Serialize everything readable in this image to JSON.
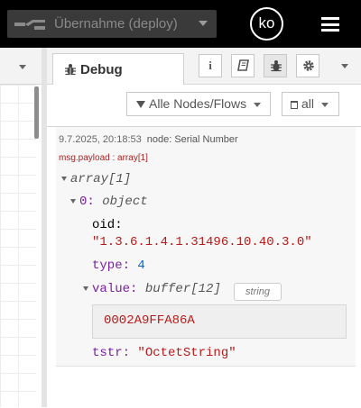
{
  "header": {
    "deploy_label": "Übernahme (deploy)",
    "avatar_initials": "ko"
  },
  "sidebar": {
    "tab_title": "Debug",
    "buttons": [
      "info",
      "help",
      "debug",
      "settings"
    ]
  },
  "filter": {
    "scope_label": "Alle Nodes/Flows",
    "clear_label": "all"
  },
  "message": {
    "timestamp": "9.7.2025, 20:18:53",
    "node_label": "node: Serial Number",
    "topic": "msg.payload : array[1]",
    "tree": {
      "root": "array[1]",
      "item_index": "0:",
      "item_type": "object",
      "oid_key": "oid:",
      "oid_value": "\"1.3.6.1.4.1.31496.10.40.3.0\"",
      "type_key": "type:",
      "type_value": "4",
      "value_key": "value:",
      "value_type": "buffer[12]",
      "value_format": "string",
      "buffer_text": "0002A9FFA86A",
      "tstr_key": "tstr:",
      "tstr_value": "\"OctetString\""
    }
  },
  "colors": {
    "header_bg": "#000000",
    "key": "#7b1fa2",
    "string": "#b71c1c",
    "number": "#1565c0"
  }
}
